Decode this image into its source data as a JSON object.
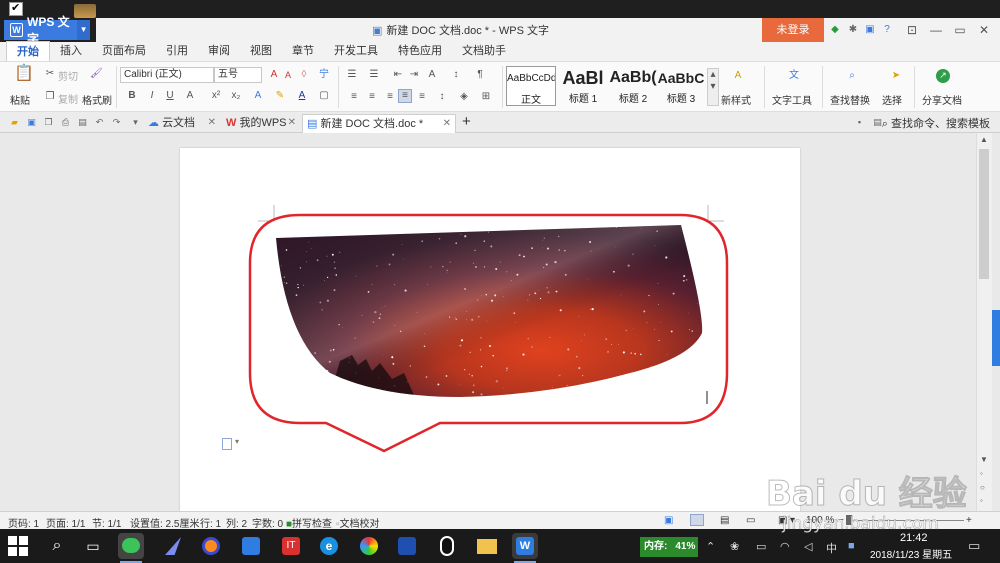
{
  "app": {
    "name": "WPS 文字",
    "doc_title": "新建 DOC 文档.doc * - WPS 文字",
    "login_label": "未登录"
  },
  "menu": {
    "tabs": [
      "开始",
      "插入",
      "页面布局",
      "引用",
      "审阅",
      "视图",
      "章节",
      "开发工具",
      "特色应用",
      "文档助手"
    ],
    "active": "开始"
  },
  "ribbon": {
    "paste": "粘贴",
    "cut": "剪切",
    "copy": "复制",
    "format_painter": "格式刷",
    "font_name": "Calibri (正文)",
    "font_size": "五号",
    "styles": [
      {
        "sample": "AaBbCcDd",
        "name": "正文"
      },
      {
        "sample": "AaBl",
        "name": "标题 1"
      },
      {
        "sample": "AaBb(",
        "name": "标题 2"
      },
      {
        "sample": "AaBbC",
        "name": "标题 3"
      }
    ],
    "new_style": "新样式",
    "text_tools": "文字工具",
    "find_replace": "查找替换",
    "select": "选择",
    "share": "分享文档"
  },
  "doc_tabs": {
    "cloud": "云文档",
    "mywps": "我的WPS",
    "current": "新建 DOC 文档.doc *",
    "search_placeholder": "查找命令、搜索模板"
  },
  "statusbar": {
    "page_code": "页码: 1",
    "pages": "页面: 1/1",
    "section": "节: 1/1",
    "setting": "设置值: 2.5厘米",
    "row": "行: 1",
    "col": "列: 2",
    "words": "字数: 0",
    "spell": "拼写检查",
    "proof": "文档校对",
    "zoom": "100 %"
  },
  "taskbar": {
    "mem_label": "内存:",
    "mem_value": "41%",
    "ime": "中",
    "time": "21:42",
    "date": "2018/11/23 星期五"
  },
  "watermark": {
    "logo": "Bai du 经验",
    "url": "jingyan.baidu.com"
  },
  "colors": {
    "accent": "#3b7be0",
    "login": "#e8693c",
    "callout": "#e0262b",
    "memory": "#2b8a2b"
  }
}
